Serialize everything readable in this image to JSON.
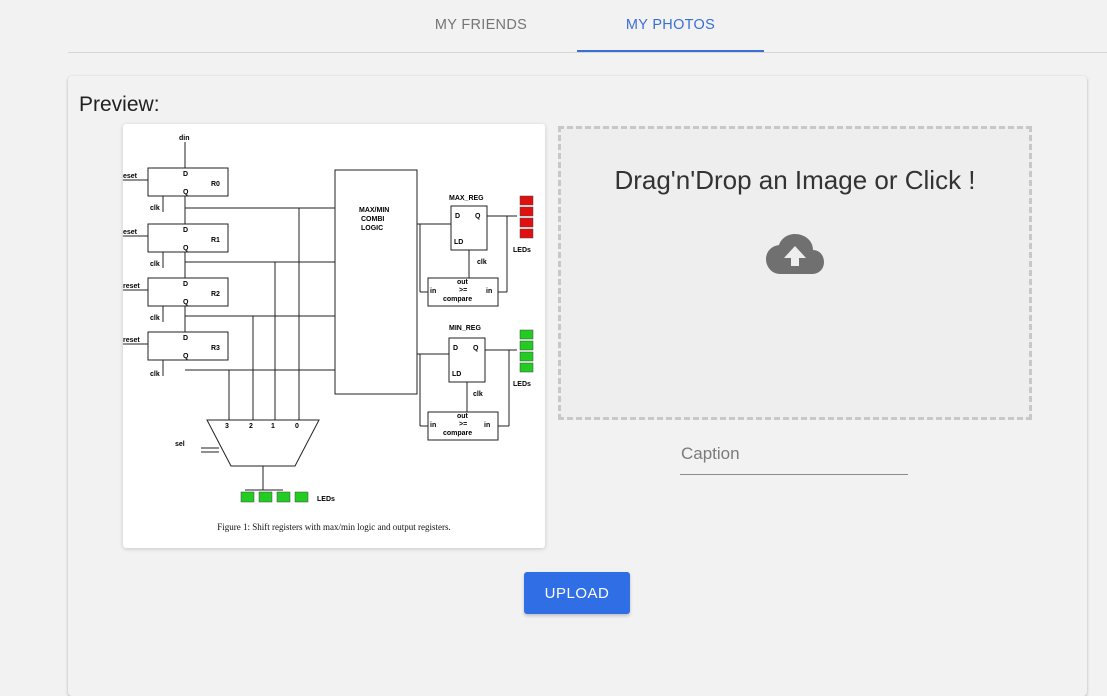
{
  "nav": {
    "tabs": [
      {
        "label": "MY FRIENDS",
        "active": false
      },
      {
        "label": "MY PHOTOS",
        "active": true
      }
    ]
  },
  "colors": {
    "accent": "#3a6fd6",
    "button": "#2f6ee5",
    "background": "#f2f2f2"
  },
  "preview": {
    "title": "Preview:",
    "image": {
      "caption": "Figure 1: Shift registers with max/min logic and output registers.",
      "labels": {
        "din": "din",
        "registers": [
          {
            "reset": "eset",
            "d": "D",
            "q": "Q",
            "name": "R0",
            "clk": "clk"
          },
          {
            "reset": "eset",
            "d": "D",
            "q": "Q",
            "name": "R1",
            "clk": "clk"
          },
          {
            "reset": "reset",
            "d": "D",
            "q": "Q",
            "name": "R2",
            "clk": "clk"
          },
          {
            "reset": "reset",
            "d": "D",
            "q": "Q",
            "name": "R3",
            "clk": "clk"
          }
        ],
        "logic_lines": [
          "MAX/MIN",
          "COMBI",
          "LOGIC"
        ],
        "max_reg": "MAX_REG",
        "min_reg": "MIN_REG",
        "d": "D",
        "q": "Q",
        "ld": "LD",
        "clk": "clk",
        "leds": "LEDs",
        "out": "out",
        "gte": ">=",
        "compare": "compare",
        "in": "in",
        "mux_inputs": [
          "3",
          "2",
          "1",
          "0"
        ],
        "sel": "sel"
      }
    }
  },
  "dropzone": {
    "text": "Drag'n'Drop an Image or Click !",
    "icon": "cloud-upload-icon"
  },
  "caption": {
    "placeholder": "Caption",
    "value": ""
  },
  "upload_button": {
    "label": "UPLOAD"
  }
}
